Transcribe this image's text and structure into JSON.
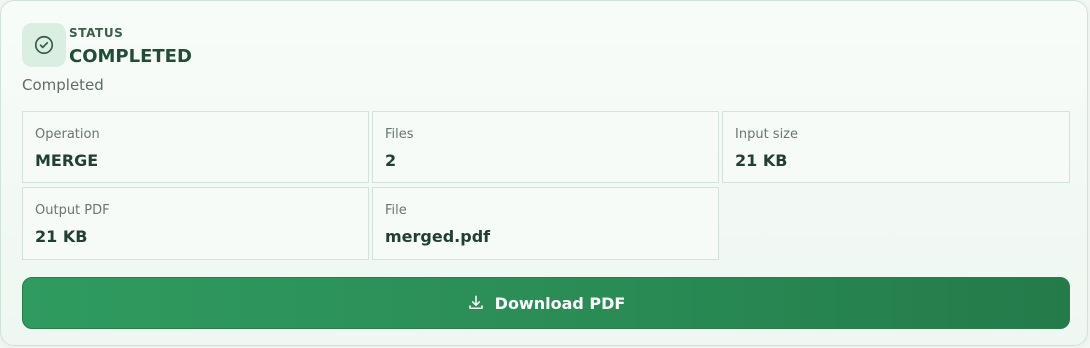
{
  "status": {
    "kicker": "STATUS",
    "title": "COMPLETED",
    "subtitle": "Completed",
    "icon": "check-circle-icon",
    "accent_color": "#2f9b5f"
  },
  "details": [
    {
      "label": "Operation",
      "value": "MERGE"
    },
    {
      "label": "Files",
      "value": "2"
    },
    {
      "label": "Input size",
      "value": "21 KB"
    },
    {
      "label": "Output PDF",
      "value": "21 KB"
    },
    {
      "label": "File",
      "value": "merged.pdf"
    }
  ],
  "actions": {
    "download_label": "Download PDF",
    "download_icon": "download-icon"
  }
}
